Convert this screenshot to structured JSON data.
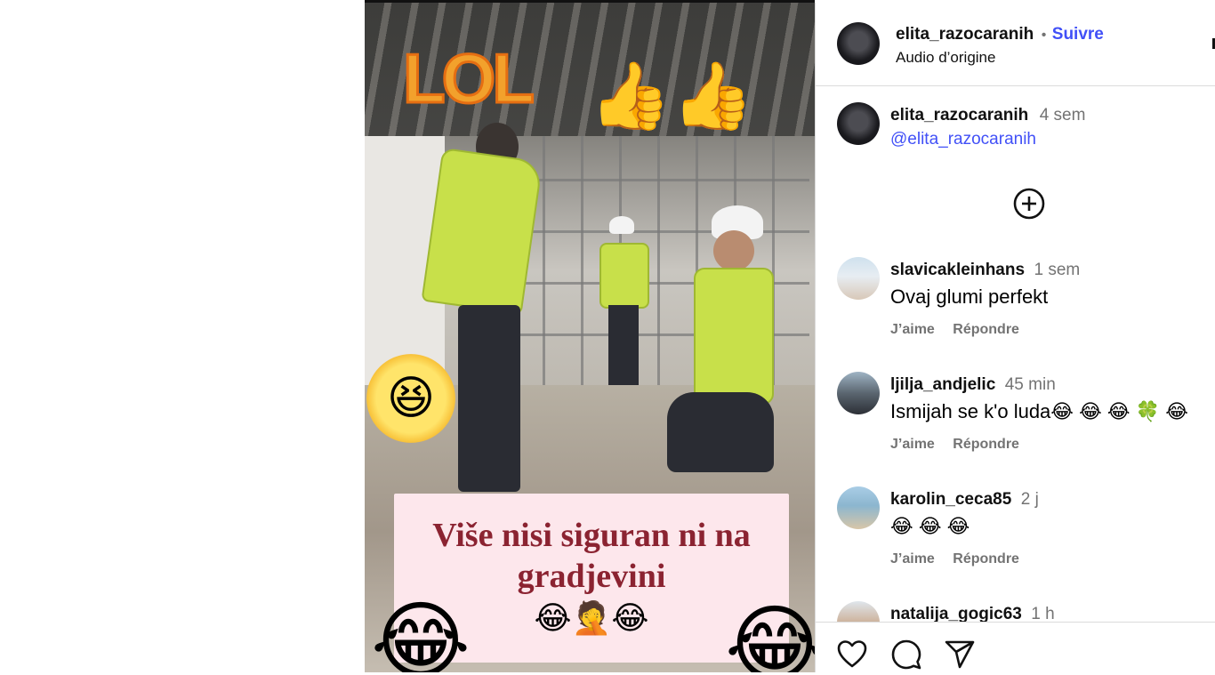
{
  "post": {
    "author": "elita_razocaranih",
    "follow_label": "Suivre",
    "separator": "•",
    "audio": "Audio d’origine"
  },
  "media": {
    "caption_line1": "Više nisi siguran ni na",
    "caption_line2": "gradjevini",
    "caption_emojis": "😂🤦😂",
    "sticker_lol": "LOL",
    "sticker_laugh": "😆",
    "sticker_thumbs": "👍👍",
    "corner_emoji": "😂"
  },
  "description": {
    "author": "elita_razocaranih",
    "time": "4 sem",
    "mention": "@elita_razocaranih"
  },
  "load_more_icon": "plus-circle-icon",
  "comments": [
    {
      "user": "slavicakleinhans",
      "time": "1 sem",
      "text": "Ovaj glumi perfekt",
      "like": "J’aime",
      "reply": "Répondre"
    },
    {
      "user": "ljilja_andjelic",
      "time": "45 min",
      "text": "Ismijah se k'o luda😂 😂 😂 🍀 😂",
      "like": "J’aime",
      "reply": "Répondre"
    },
    {
      "user": "karolin_ceca85",
      "time": "2 j",
      "text": "😂 😂 😂",
      "like": "J’aime",
      "reply": "Répondre"
    },
    {
      "user": "natalija_gogic63",
      "time": "1 h"
    }
  ],
  "footer_icons": [
    "heart-icon",
    "comment-icon",
    "share-icon"
  ],
  "colors": {
    "link": "#4150f7",
    "muted": "#737373",
    "caption_text": "#8b2331",
    "caption_bg": "#fde7ec"
  }
}
